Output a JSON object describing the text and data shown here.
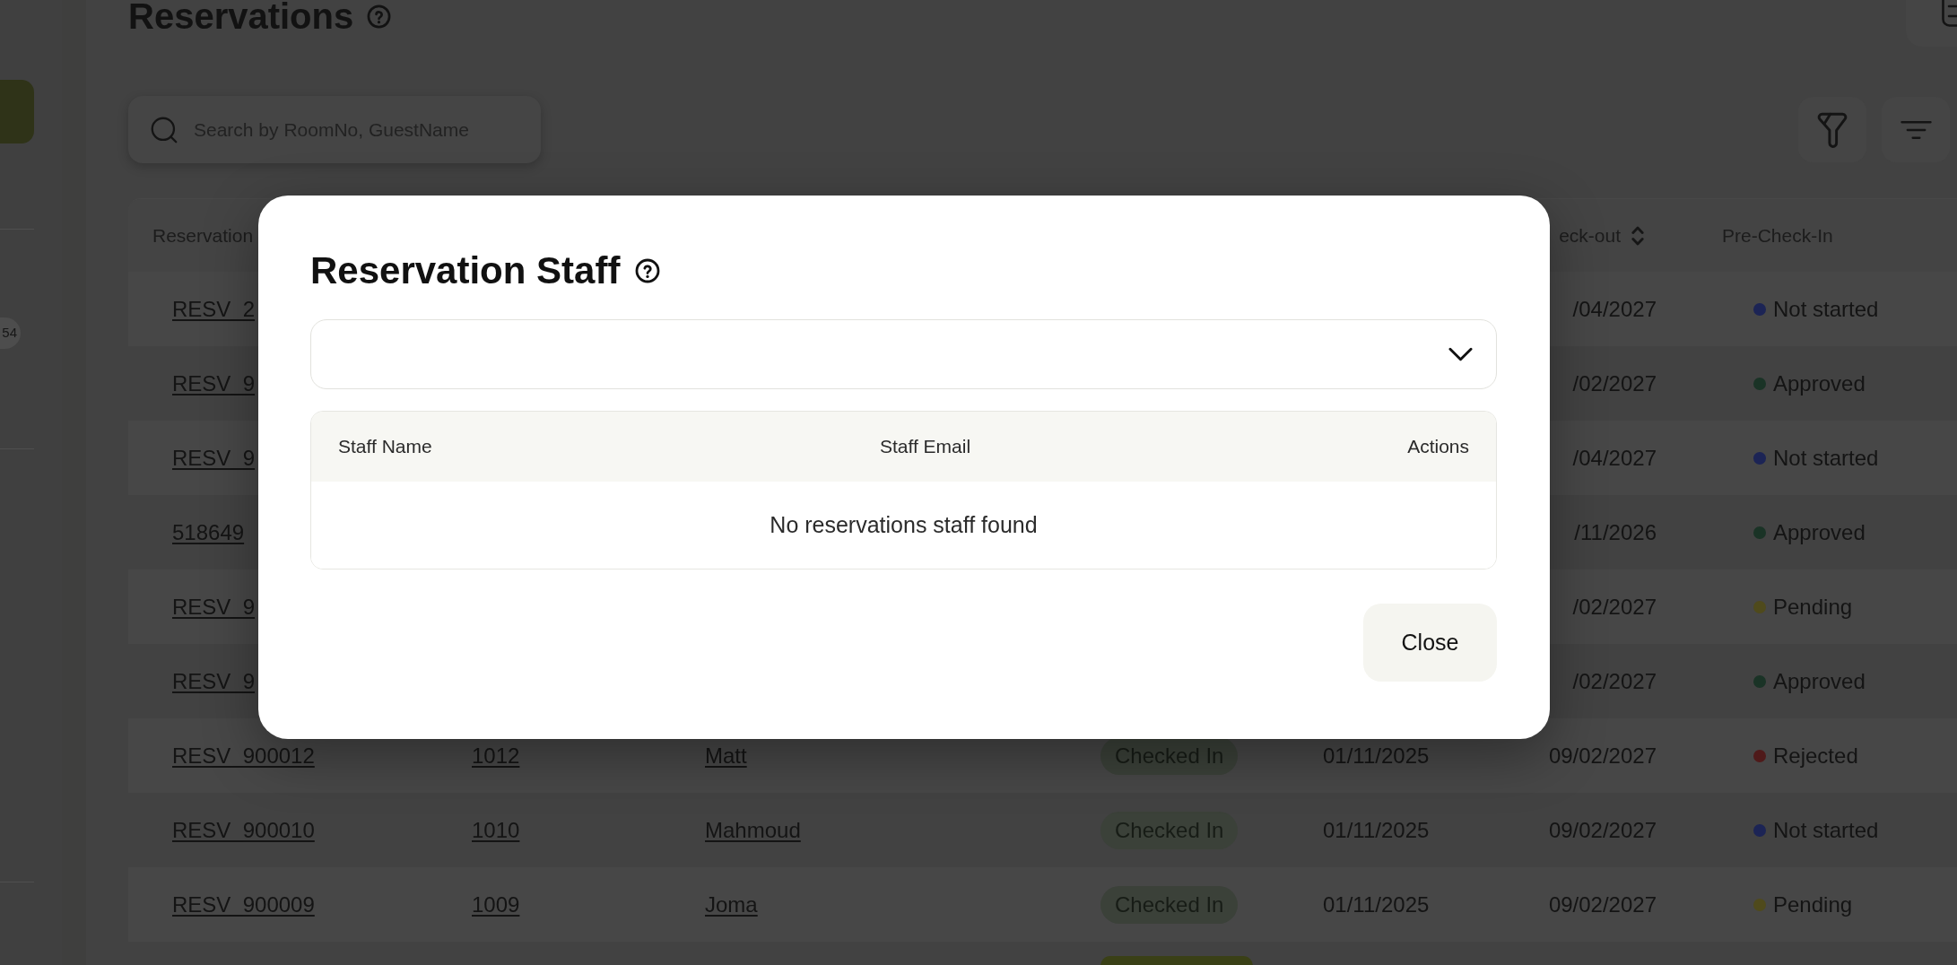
{
  "sidebar": {
    "items": [
      {
        "selected": true
      }
    ],
    "badge": "54"
  },
  "page": {
    "title": "Reservations",
    "search": {
      "placeholder": "Search by RoomNo, GuestName"
    }
  },
  "table": {
    "header": {
      "column_1": {
        "label": "Reservation"
      },
      "column_6": {
        "label": "eck-out",
        "sortable": true
      },
      "column_7": {
        "label": "Pre-Check-In",
        "sortable": false
      }
    },
    "rows": [
      {
        "column_1": "RESV_2",
        "column_6": "/04/2027",
        "column_7": {
          "label": "Not started",
          "color": "#1c2455"
        }
      },
      {
        "column_1": "RESV_9",
        "column_6": "/02/2027",
        "column_7": {
          "label": "Approved",
          "color": "#1a3326"
        }
      },
      {
        "column_1": "RESV_9",
        "column_6": "/04/2027",
        "column_7": {
          "label": "Not started",
          "color": "#1c2455"
        }
      },
      {
        "column_1": "518649",
        "column_6": "/11/2026",
        "column_7": {
          "label": "Approved",
          "color": "#1a3326"
        }
      },
      {
        "column_1": "RESV_9",
        "column_6": "/02/2027",
        "column_7": {
          "label": "Pending",
          "color": "#4f4a1c"
        }
      },
      {
        "column_1": "RESV_9",
        "column_6": "/02/2027",
        "column_7": {
          "label": "Approved",
          "color": "#1a3326"
        }
      },
      {
        "column_1": "RESV_900012",
        "column_2": "1012",
        "column_3": "Matt",
        "column_4": {
          "label": "Checked In",
          "color": "#3b4139"
        },
        "column_5": "01/11/2025",
        "column_6": "09/02/2027",
        "column_7": {
          "label": "Rejected",
          "color": "#4f1a1a"
        }
      },
      {
        "column_1": "RESV_900010",
        "column_2": "1010",
        "column_3": "Mahmoud",
        "column_4": {
          "label": "Checked In",
          "color": "#3b4139"
        },
        "column_5": "01/11/2025",
        "column_6": "09/02/2027",
        "column_7": {
          "label": "Not started",
          "color": "#1c2455"
        }
      },
      {
        "column_1": "RESV_900009",
        "column_2": "1009",
        "column_3": "Joma",
        "column_4": {
          "label": "Checked In",
          "color": "#3b4139"
        },
        "column_5": "01/11/2025",
        "column_6": "09/02/2027",
        "column_7": {
          "label": "Pending",
          "color": "#4f4a1c"
        }
      },
      {
        "column_4": {
          "color": "#3a4016"
        }
      }
    ]
  },
  "dialog": {
    "title": "Reservation Staff",
    "table": {
      "columns": [
        "Staff Name",
        "Staff Email",
        "Actions"
      ],
      "empty_message": "No reservations staff found"
    },
    "buttons": [
      "Close"
    ]
  }
}
